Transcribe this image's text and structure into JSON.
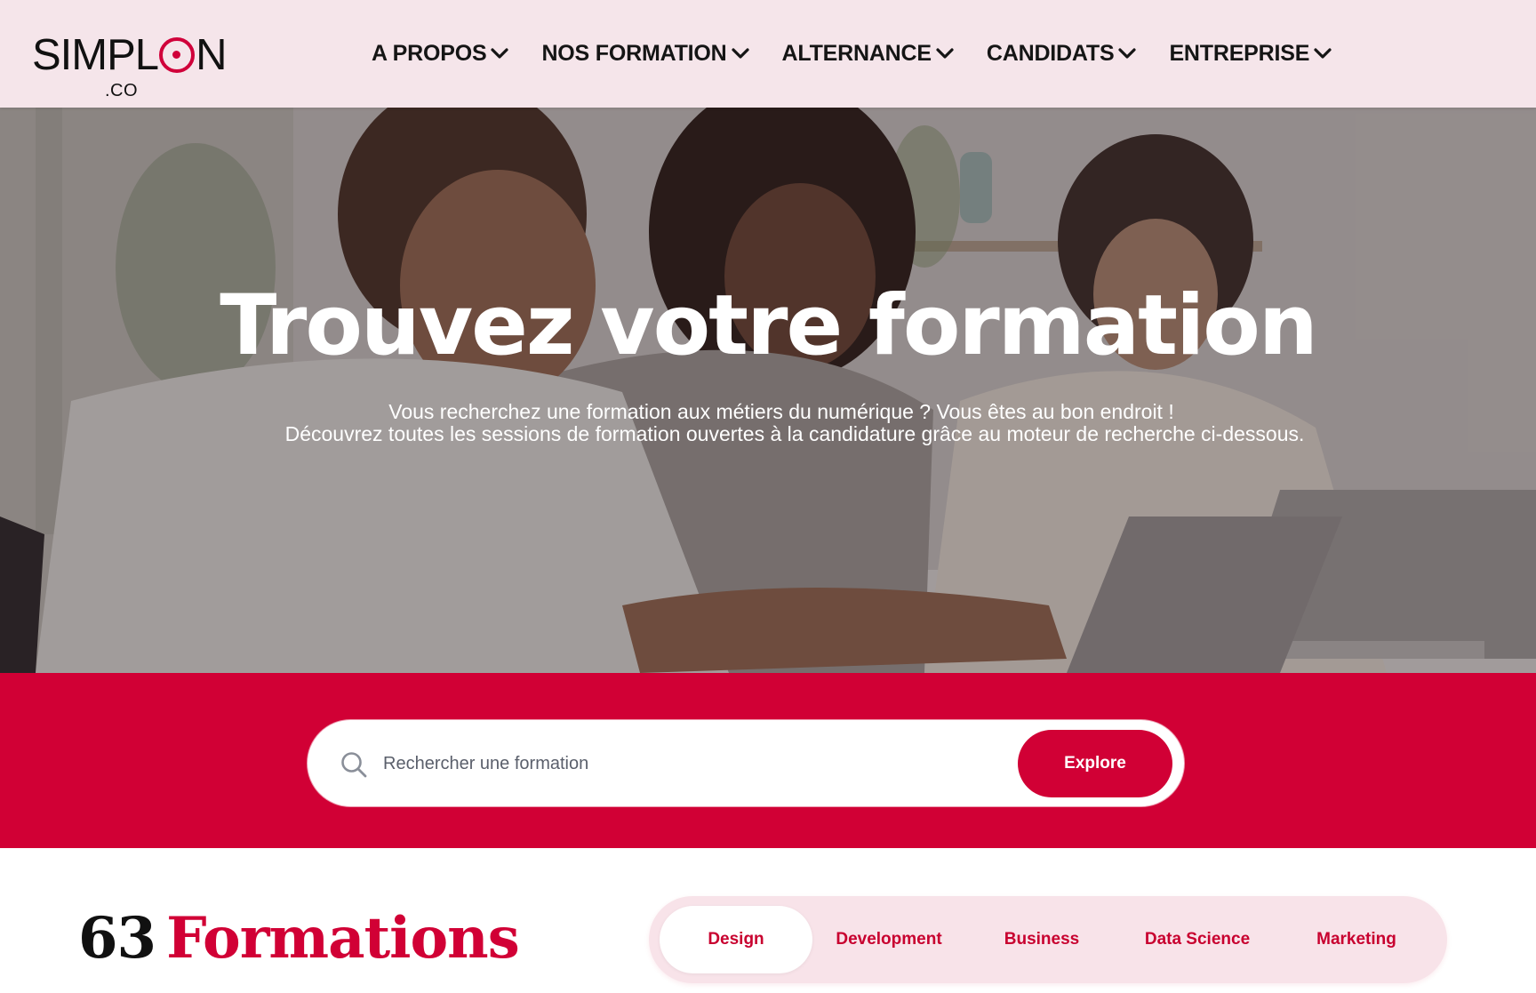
{
  "header": {
    "logo": {
      "word": "SIMPL",
      "word_end": "N",
      "suffix": ".CO"
    },
    "nav": [
      {
        "label": "A PROPOS"
      },
      {
        "label": "NOS FORMATION"
      },
      {
        "label": "ALTERNANCE"
      },
      {
        "label": "CANDIDATS"
      },
      {
        "label": "ENTREPRISE"
      }
    ]
  },
  "hero": {
    "title": "Trouvez votre formation",
    "subtitle_line1": "Vous recherchez une formation aux métiers du numérique ? Vous êtes au bon endroit !",
    "subtitle_line2": "Découvrez toutes les sessions de formation ouvertes à la candidature grâce au moteur de recherche ci-dessous."
  },
  "search": {
    "placeholder": "Rechercher une formation",
    "value": "",
    "button_label": "Explore",
    "icon": "search-icon"
  },
  "results": {
    "count": "63",
    "label": "Formations"
  },
  "categories": {
    "active": "Design",
    "tabs": [
      {
        "label": "Design"
      },
      {
        "label": "Development"
      },
      {
        "label": "Business"
      },
      {
        "label": "Data Science"
      },
      {
        "label": "Marketing"
      }
    ]
  },
  "colors": {
    "brand": "#d10035",
    "header_bg": "#f5e5ea",
    "tabs_bg": "#f8e3e9"
  }
}
